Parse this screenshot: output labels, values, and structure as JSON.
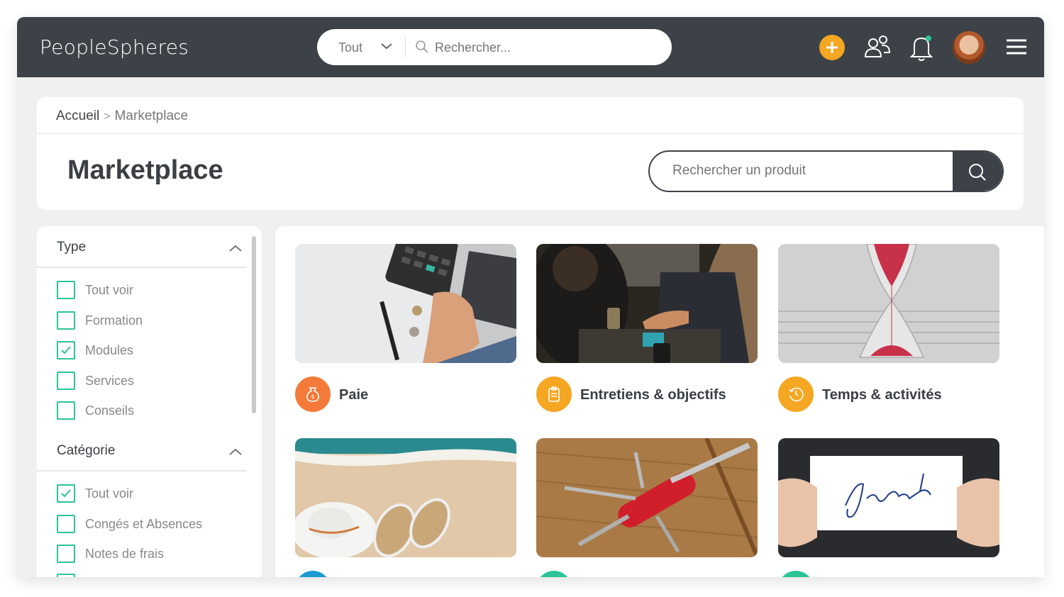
{
  "topbar": {
    "logo_text": "PeopleSpheres",
    "scope_label": "Tout",
    "search_placeholder": "Rechercher...",
    "accent_color": "#f5a623"
  },
  "breadcrumb": {
    "home": "Accueil",
    "current": "Marketplace"
  },
  "page": {
    "title": "Marketplace",
    "product_search_placeholder": "Rechercher un produit"
  },
  "filters": {
    "type_title": "Type",
    "type_items": [
      {
        "label": "Tout voir",
        "checked": false
      },
      {
        "label": "Formation",
        "checked": false
      },
      {
        "label": "Modules",
        "checked": true
      },
      {
        "label": "Services",
        "checked": false
      },
      {
        "label": "Conseils",
        "checked": false
      }
    ],
    "category_title": "Catégorie",
    "category_items": [
      {
        "label": "Tout voir",
        "checked": true
      },
      {
        "label": "Congés et Absences",
        "checked": false
      },
      {
        "label": "Notes de frais",
        "checked": false
      }
    ],
    "checkbox_color": "#2cc497"
  },
  "products": [
    {
      "name": "Paie",
      "icon": "money-bag-icon",
      "color": "#f47a3a",
      "image": "calculator-laptop"
    },
    {
      "name": "Entretiens & objectifs",
      "icon": "clipboard-icon",
      "color": "#f5a623",
      "image": "handshake"
    },
    {
      "name": "Temps & activités",
      "icon": "history-clock-icon",
      "color": "#f5a623",
      "image": "hourglass"
    },
    {
      "name": "",
      "icon": "",
      "color": "#1b9bd1",
      "image": "beach-hat-sandals"
    },
    {
      "name": "",
      "icon": "",
      "color": "#2cc497",
      "image": "swiss-army-knife"
    },
    {
      "name": "",
      "icon": "",
      "color": "#2cc497",
      "image": "join-us-sign"
    }
  ]
}
